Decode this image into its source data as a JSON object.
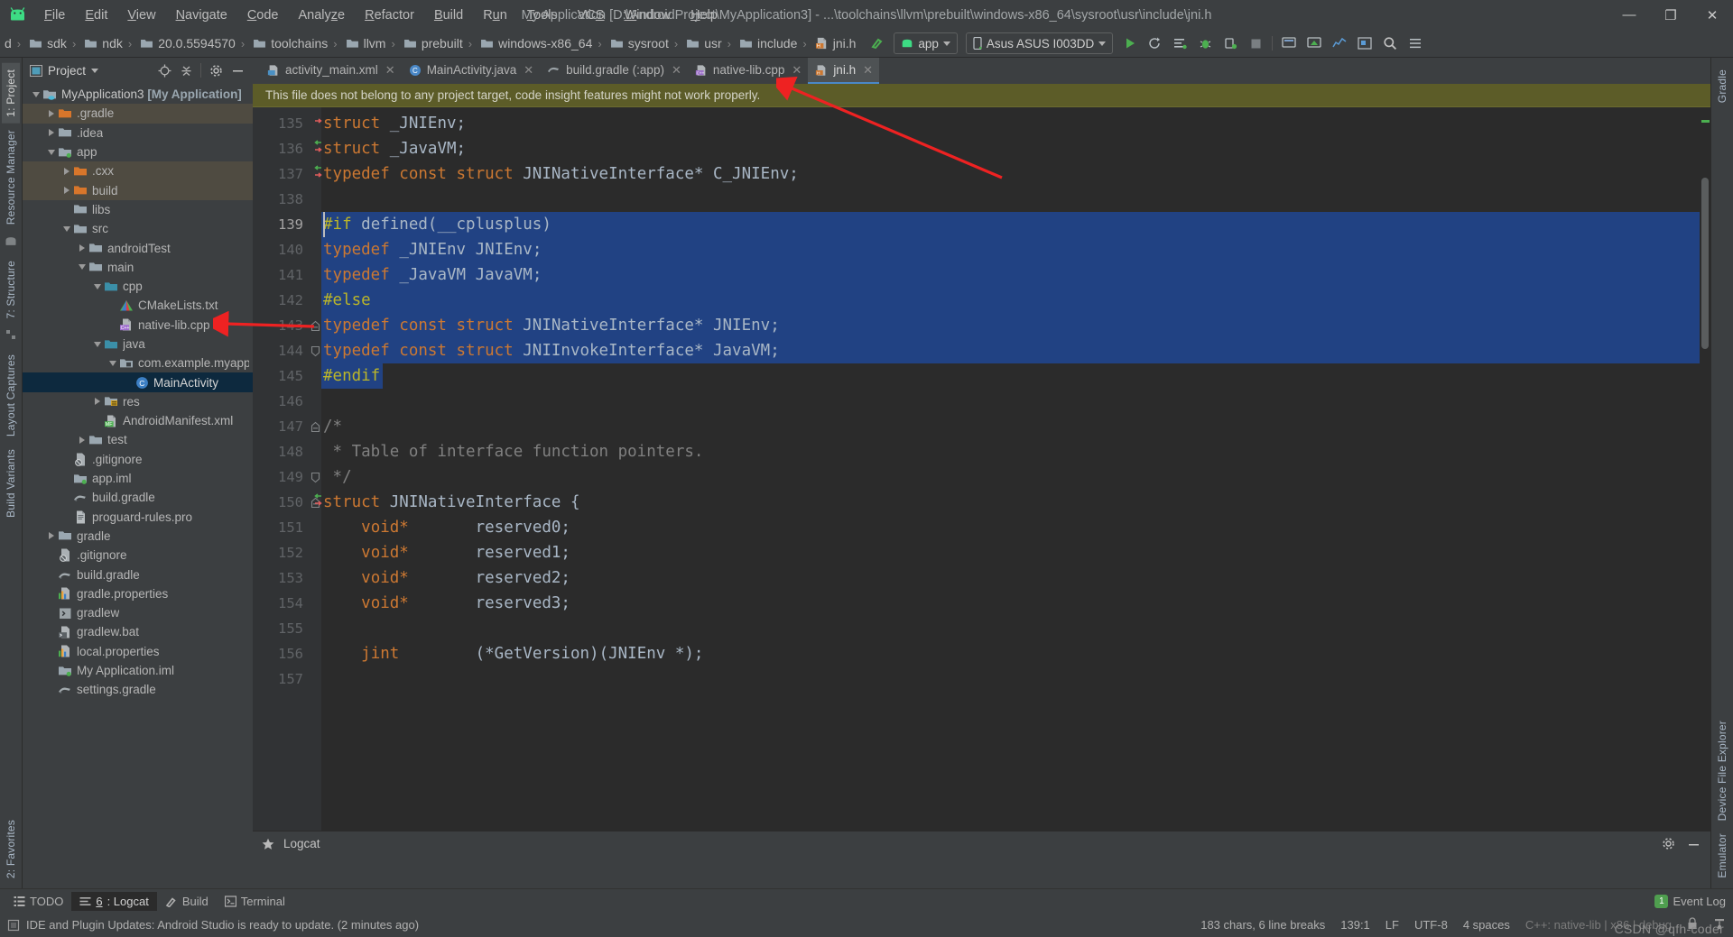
{
  "window": {
    "title": "My Application [D:\\AndroidProject\\MyApplication3] - ...\\toolchains\\llvm\\prebuilt\\windows-x86_64\\sysroot\\usr\\include\\jni.h",
    "minimize": "—",
    "maximize": "❐",
    "close": "✕"
  },
  "menu": [
    {
      "pre": "",
      "u": "F",
      "post": "ile"
    },
    {
      "pre": "",
      "u": "E",
      "post": "dit"
    },
    {
      "pre": "",
      "u": "V",
      "post": "iew"
    },
    {
      "pre": "",
      "u": "N",
      "post": "avigate"
    },
    {
      "pre": "",
      "u": "C",
      "post": "ode"
    },
    {
      "pre": "Analy",
      "u": "z",
      "post": "e"
    },
    {
      "pre": "",
      "u": "R",
      "post": "efactor"
    },
    {
      "pre": "",
      "u": "B",
      "post": "uild"
    },
    {
      "pre": "R",
      "u": "u",
      "post": "n"
    },
    {
      "pre": "",
      "u": "T",
      "post": "ools"
    },
    {
      "pre": "VC",
      "u": "S",
      "post": ""
    },
    {
      "pre": "",
      "u": "W",
      "post": "indow"
    },
    {
      "pre": "",
      "u": "H",
      "post": "elp"
    }
  ],
  "breadcrumbs": [
    {
      "label": "d",
      "icon": "none"
    },
    {
      "label": "sdk",
      "icon": "folder"
    },
    {
      "label": "ndk",
      "icon": "folder"
    },
    {
      "label": "20.0.5594570",
      "icon": "folder"
    },
    {
      "label": "toolchains",
      "icon": "folder"
    },
    {
      "label": "llvm",
      "icon": "folder"
    },
    {
      "label": "prebuilt",
      "icon": "folder"
    },
    {
      "label": "windows-x86_64",
      "icon": "folder"
    },
    {
      "label": "sysroot",
      "icon": "folder"
    },
    {
      "label": "usr",
      "icon": "folder"
    },
    {
      "label": "include",
      "icon": "folder"
    },
    {
      "label": "jni.h",
      "icon": "header-file"
    }
  ],
  "toolbar": {
    "module_selector": "app",
    "device_selector": "Asus ASUS I003DD",
    "run_icon": "run-icon",
    "rerun_icon": "rerun-icon",
    "apply_changes_icon": "apply-changes-icon",
    "debug_icon": "debug-icon",
    "attach_debugger_icon": "attach-debugger-icon",
    "stop_icon": "stop-icon",
    "sdk_manager_icon": "sdk-manager-icon",
    "avd_manager_icon": "avd-manager-icon",
    "profiler_icon": "profiler-icon",
    "layout_inspector_icon": "layout-inspector-icon",
    "search_icon": "search-icon",
    "more_icon": "more-icon"
  },
  "project_panel": {
    "title": "Project",
    "select_opened_file_icon": "locate-icon",
    "collapse_all_icon": "collapse-all-icon",
    "settings_icon": "gear-icon",
    "hide_icon": "hide-icon",
    "tree": [
      {
        "depth": 0,
        "arrow": "down",
        "icon": "project-root",
        "label": "MyApplication3 ",
        "suffix": "[My Application]",
        "state": "normal"
      },
      {
        "depth": 1,
        "arrow": "right",
        "icon": "folder-orange",
        "label": ".gradle",
        "state": "excluded"
      },
      {
        "depth": 1,
        "arrow": "right",
        "icon": "folder-gray",
        "label": ".idea",
        "state": "normal"
      },
      {
        "depth": 1,
        "arrow": "down",
        "icon": "module",
        "label": "app",
        "state": "normal"
      },
      {
        "depth": 2,
        "arrow": "right",
        "icon": "folder-orange",
        "label": ".cxx",
        "state": "excluded"
      },
      {
        "depth": 2,
        "arrow": "right",
        "icon": "folder-orange",
        "label": "build",
        "state": "excluded"
      },
      {
        "depth": 2,
        "arrow": "none",
        "icon": "folder-gray",
        "label": "libs",
        "state": "normal"
      },
      {
        "depth": 2,
        "arrow": "down",
        "icon": "folder-gray",
        "label": "src",
        "state": "normal"
      },
      {
        "depth": 3,
        "arrow": "right",
        "icon": "folder-gray",
        "label": "androidTest",
        "state": "normal"
      },
      {
        "depth": 3,
        "arrow": "down",
        "icon": "folder-gray",
        "label": "main",
        "state": "normal"
      },
      {
        "depth": 4,
        "arrow": "down",
        "icon": "folder-teal",
        "label": "cpp",
        "state": "normal"
      },
      {
        "depth": 5,
        "arrow": "none",
        "icon": "cmake",
        "label": "CMakeLists.txt",
        "state": "normal"
      },
      {
        "depth": 5,
        "arrow": "none",
        "icon": "cpp-file",
        "label": "native-lib.cpp",
        "state": "normal"
      },
      {
        "depth": 4,
        "arrow": "down",
        "icon": "folder-teal",
        "label": "java",
        "state": "normal"
      },
      {
        "depth": 5,
        "arrow": "down",
        "icon": "package",
        "label": "com.example.myappl",
        "state": "normal"
      },
      {
        "depth": 6,
        "arrow": "none",
        "icon": "class",
        "label": "MainActivity",
        "state": "selected"
      },
      {
        "depth": 4,
        "arrow": "right",
        "icon": "folder-res",
        "label": "res",
        "state": "normal"
      },
      {
        "depth": 4,
        "arrow": "none",
        "icon": "manifest",
        "label": "AndroidManifest.xml",
        "state": "normal"
      },
      {
        "depth": 3,
        "arrow": "right",
        "icon": "folder-gray",
        "label": "test",
        "state": "normal"
      },
      {
        "depth": 2,
        "arrow": "none",
        "icon": "gitignore",
        "label": ".gitignore",
        "state": "normal"
      },
      {
        "depth": 2,
        "arrow": "none",
        "icon": "module",
        "label": "app.iml",
        "state": "normal"
      },
      {
        "depth": 2,
        "arrow": "none",
        "icon": "gradle",
        "label": "build.gradle",
        "state": "normal"
      },
      {
        "depth": 2,
        "arrow": "none",
        "icon": "text-file",
        "label": "proguard-rules.pro",
        "state": "normal"
      },
      {
        "depth": 1,
        "arrow": "right",
        "icon": "folder-gray",
        "label": "gradle",
        "state": "normal"
      },
      {
        "depth": 1,
        "arrow": "none",
        "icon": "gitignore",
        "label": ".gitignore",
        "state": "normal"
      },
      {
        "depth": 1,
        "arrow": "none",
        "icon": "gradle",
        "label": "build.gradle",
        "state": "normal"
      },
      {
        "depth": 1,
        "arrow": "none",
        "icon": "properties",
        "label": "gradle.properties",
        "state": "normal"
      },
      {
        "depth": 1,
        "arrow": "none",
        "icon": "script",
        "label": "gradlew",
        "state": "normal"
      },
      {
        "depth": 1,
        "arrow": "none",
        "icon": "bat-file",
        "label": "gradlew.bat",
        "state": "normal"
      },
      {
        "depth": 1,
        "arrow": "none",
        "icon": "properties",
        "label": "local.properties",
        "state": "normal"
      },
      {
        "depth": 1,
        "arrow": "none",
        "icon": "iml",
        "label": "My Application.iml",
        "state": "normal"
      },
      {
        "depth": 1,
        "arrow": "none",
        "icon": "gradle",
        "label": "settings.gradle",
        "state": "normal"
      }
    ]
  },
  "left_rail": {
    "project_tab": "1: Project",
    "resource_manager_tab": "Resource Manager",
    "structure_tab": "7: Structure",
    "layout_captures_tab": "Layout Captures",
    "build_variants_tab": "Build Variants",
    "favorites_tab": "2: Favorites"
  },
  "right_rail": {
    "gradle_tab": "Gradle",
    "device_file_explorer_tab": "Device File Explorer",
    "emulator_tab": "Emulator"
  },
  "editor_tabs": [
    {
      "label": "activity_main.xml",
      "icon": "xml-file",
      "active": false
    },
    {
      "label": "MainActivity.java",
      "icon": "java-class",
      "active": false
    },
    {
      "label": "build.gradle (:app)",
      "icon": "gradle-file",
      "active": false
    },
    {
      "label": "native-lib.cpp",
      "icon": "cpp-file",
      "active": false
    },
    {
      "label": "jni.h",
      "icon": "header-file",
      "active": true
    }
  ],
  "notice": {
    "text": "This file does not belong to any project target, code insight features might not work properly."
  },
  "code": {
    "lines": [
      {
        "n": 135,
        "mark": "out",
        "fold": "none",
        "sel": false,
        "tokens": [
          {
            "t": "kw",
            "v": "struct"
          },
          {
            "t": "sp",
            "v": " "
          },
          {
            "t": "id",
            "v": "_JNIEnv;"
          }
        ]
      },
      {
        "n": 136,
        "mark": "both",
        "fold": "none",
        "sel": false,
        "tokens": [
          {
            "t": "kw",
            "v": "struct"
          },
          {
            "t": "sp",
            "v": " "
          },
          {
            "t": "id",
            "v": "_JavaVM;"
          }
        ]
      },
      {
        "n": 137,
        "mark": "both",
        "fold": "none",
        "sel": false,
        "tokens": [
          {
            "t": "kw",
            "v": "typedef const struct"
          },
          {
            "t": "sp",
            "v": " "
          },
          {
            "t": "id",
            "v": "JNINativeInterface* C_JNIEnv;"
          }
        ]
      },
      {
        "n": 138,
        "mark": "none",
        "fold": "none",
        "sel": false,
        "tokens": []
      },
      {
        "n": 139,
        "mark": "none",
        "fold": "none",
        "sel": true,
        "cur": true,
        "tokens": [
          {
            "t": "pp",
            "v": "#if"
          },
          {
            "t": "sp",
            "v": " "
          },
          {
            "t": "id",
            "v": "defined(__cplusplus)"
          }
        ]
      },
      {
        "n": 140,
        "mark": "none",
        "fold": "none",
        "sel": true,
        "tokens": [
          {
            "t": "kw",
            "v": "typedef"
          },
          {
            "t": "sp",
            "v": " "
          },
          {
            "t": "id",
            "v": "_JNIEnv JNIEnv;"
          }
        ]
      },
      {
        "n": 141,
        "mark": "none",
        "fold": "none",
        "sel": true,
        "tokens": [
          {
            "t": "kw",
            "v": "typedef"
          },
          {
            "t": "sp",
            "v": " "
          },
          {
            "t": "id",
            "v": "_JavaVM JavaVM;"
          }
        ]
      },
      {
        "n": 142,
        "mark": "none",
        "fold": "none",
        "sel": true,
        "tokens": [
          {
            "t": "pp",
            "v": "#else"
          }
        ]
      },
      {
        "n": 143,
        "mark": "none",
        "fold": "top",
        "sel": true,
        "tokens": [
          {
            "t": "kw",
            "v": "typedef const struct"
          },
          {
            "t": "sp",
            "v": " "
          },
          {
            "t": "id",
            "v": "JNINativeInterface* JNIEnv;"
          }
        ]
      },
      {
        "n": 144,
        "mark": "none",
        "fold": "bottom",
        "sel": true,
        "tokens": [
          {
            "t": "kw",
            "v": "typedef const struct"
          },
          {
            "t": "sp",
            "v": " "
          },
          {
            "t": "id",
            "v": "JNIInvokeInterface* JavaVM;"
          }
        ]
      },
      {
        "n": 145,
        "mark": "none",
        "fold": "none",
        "sel": "partial",
        "selwidth": 68,
        "tokens": [
          {
            "t": "pp",
            "v": "#endif"
          }
        ]
      },
      {
        "n": 146,
        "mark": "none",
        "fold": "none",
        "sel": false,
        "tokens": []
      },
      {
        "n": 147,
        "mark": "none",
        "fold": "top",
        "sel": false,
        "tokens": [
          {
            "t": "cm",
            "v": "/*"
          }
        ]
      },
      {
        "n": 148,
        "mark": "none",
        "fold": "none",
        "sel": false,
        "tokens": [
          {
            "t": "cm",
            "v": " * Table of interface function pointers."
          }
        ]
      },
      {
        "n": 149,
        "mark": "none",
        "fold": "bottom",
        "sel": false,
        "tokens": [
          {
            "t": "cm",
            "v": " */"
          }
        ]
      },
      {
        "n": 150,
        "mark": "both",
        "fold": "top",
        "sel": false,
        "tokens": [
          {
            "t": "kw",
            "v": "struct"
          },
          {
            "t": "sp",
            "v": " "
          },
          {
            "t": "id",
            "v": "JNINativeInterface {"
          }
        ]
      },
      {
        "n": 151,
        "mark": "none",
        "fold": "none",
        "sel": false,
        "tokens": [
          {
            "t": "sp",
            "v": "    "
          },
          {
            "t": "kw",
            "v": "void*"
          },
          {
            "t": "sp",
            "v": "       "
          },
          {
            "t": "id",
            "v": "reserved0;"
          }
        ]
      },
      {
        "n": 152,
        "mark": "none",
        "fold": "none",
        "sel": false,
        "tokens": [
          {
            "t": "sp",
            "v": "    "
          },
          {
            "t": "kw",
            "v": "void*"
          },
          {
            "t": "sp",
            "v": "       "
          },
          {
            "t": "id",
            "v": "reserved1;"
          }
        ]
      },
      {
        "n": 153,
        "mark": "none",
        "fold": "none",
        "sel": false,
        "tokens": [
          {
            "t": "sp",
            "v": "    "
          },
          {
            "t": "kw",
            "v": "void*"
          },
          {
            "t": "sp",
            "v": "       "
          },
          {
            "t": "id",
            "v": "reserved2;"
          }
        ]
      },
      {
        "n": 154,
        "mark": "none",
        "fold": "none",
        "sel": false,
        "tokens": [
          {
            "t": "sp",
            "v": "    "
          },
          {
            "t": "kw",
            "v": "void*"
          },
          {
            "t": "sp",
            "v": "       "
          },
          {
            "t": "id",
            "v": "reserved3;"
          }
        ]
      },
      {
        "n": 155,
        "mark": "none",
        "fold": "none",
        "sel": false,
        "tokens": []
      },
      {
        "n": 156,
        "mark": "none",
        "fold": "none",
        "sel": false,
        "tokens": [
          {
            "t": "sp",
            "v": "    "
          },
          {
            "t": "kw",
            "v": "jint"
          },
          {
            "t": "sp",
            "v": "        "
          },
          {
            "t": "id",
            "v": "(*GetVersion)(JNIEnv *);"
          }
        ]
      },
      {
        "n": 157,
        "mark": "none",
        "fold": "none",
        "sel": false,
        "tokens": []
      }
    ]
  },
  "logcat_panel": {
    "title": "Logcat",
    "settings_icon": "gear-icon",
    "hide_icon": "minimize-icon"
  },
  "bottom_tabs": [
    {
      "label": "TODO",
      "icon": "todo-icon",
      "active": false,
      "num": ""
    },
    {
      "label": ": Logcat",
      "icon": "logcat-icon",
      "active": true,
      "num": "6"
    },
    {
      "label": "Build",
      "icon": "build-icon",
      "active": false,
      "num": ""
    },
    {
      "label": "Terminal",
      "icon": "terminal-icon",
      "active": false,
      "num": ""
    }
  ],
  "event_log": {
    "label": "Event Log",
    "count": "1"
  },
  "status": {
    "message": "IDE and Plugin Updates: Android Studio is ready to update. (2 minutes ago)",
    "chars": "183 chars, 6 line breaks",
    "caret": "139:1",
    "line_sep": "LF",
    "encoding": "UTF-8",
    "indent": "4 spaces",
    "context": "C++: native-lib | x86 | debug",
    "lock_icon": "lock-icon",
    "inspection_icon": "inspection-icon"
  },
  "watermark": "CSDN @qfh-coder",
  "colors": {
    "accent_blue": "#214283",
    "tab_underline": "#4a88c7",
    "notice_bg": "#5c5c28",
    "selection_tree": "#0d293e",
    "keyword_orange": "#cc7832",
    "preproc_yellow": "#bbb529",
    "comment_gray": "#808080",
    "annotation_red": "#ee2222"
  }
}
